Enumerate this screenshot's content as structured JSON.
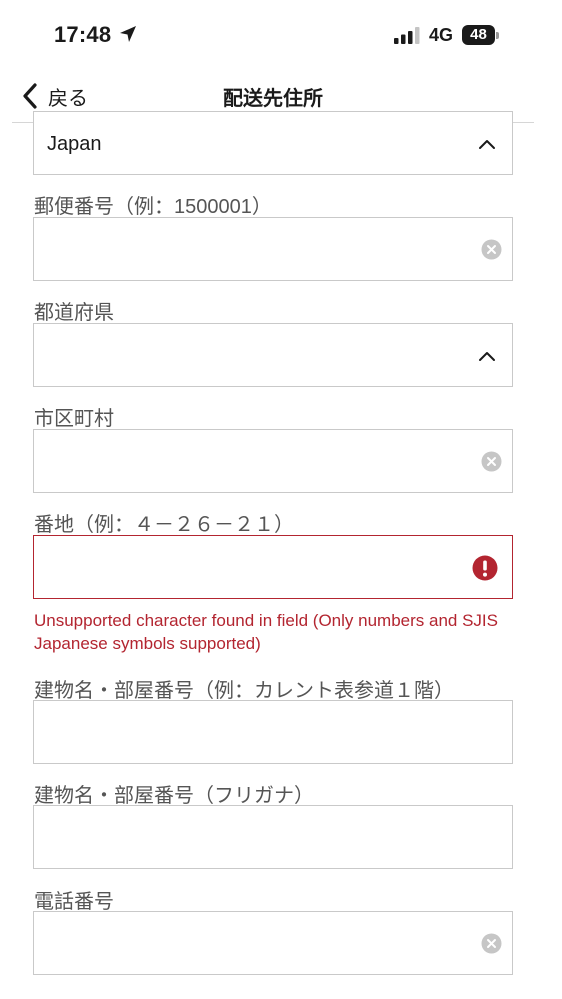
{
  "status_bar": {
    "time": "17:48",
    "network": "4G",
    "battery": "48"
  },
  "nav": {
    "back_label": "戻る",
    "title": "配送先住所"
  },
  "form": {
    "country": {
      "value": "Japan"
    },
    "postal_code": {
      "label": "郵便番号（例：1500001）",
      "value": ""
    },
    "prefecture": {
      "label": "都道府県",
      "value": ""
    },
    "city": {
      "label": "市区町村",
      "value": ""
    },
    "street": {
      "label": "番地（例：４－２６－２１）",
      "value": "",
      "error": "Unsupported character found in field (Only numbers and SJIS Japanese symbols supported)"
    },
    "building": {
      "label": "建物名・部屋番号（例：カレント表参道１階）",
      "value": ""
    },
    "building_kana": {
      "label": "建物名・部屋番号（フリガナ）",
      "value": ""
    },
    "phone": {
      "label": "電話番号",
      "value": ""
    }
  },
  "colors": {
    "error": "#b32530",
    "border": "#c9c9c9",
    "label": "#555555"
  }
}
